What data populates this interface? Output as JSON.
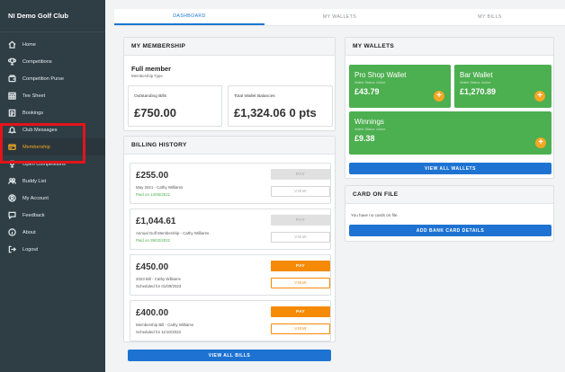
{
  "brand": "NI Demo Golf Club",
  "nav": [
    {
      "label": "Home",
      "icon": "home-icon"
    },
    {
      "label": "Competitions",
      "icon": "trophy-icon"
    },
    {
      "label": "Competition Purse",
      "icon": "purse-icon"
    },
    {
      "label": "Tee Sheet",
      "icon": "calendar-icon"
    },
    {
      "label": "Bookings",
      "icon": "bookings-icon"
    },
    {
      "label": "Club Messages",
      "icon": "bell-icon"
    },
    {
      "label": "Membership",
      "icon": "card-icon",
      "active": true
    },
    {
      "label": "Open Competitions",
      "icon": "trophy-icon"
    },
    {
      "label": "Buddy List",
      "icon": "group-icon"
    },
    {
      "label": "My Account",
      "icon": "user-icon"
    },
    {
      "label": "Feedback",
      "icon": "chat-icon"
    },
    {
      "label": "About",
      "icon": "info-icon"
    },
    {
      "label": "Logout",
      "icon": "logout-icon"
    }
  ],
  "tabs": [
    "DASHBOARD",
    "MY WALLETS",
    "MY BILLS"
  ],
  "membership": {
    "header": "MY MEMBERSHIP",
    "type": "Full member",
    "type_label": "Membership Type",
    "outstanding_label": "Outstanding Bills",
    "outstanding_value": "£750.00",
    "wallet_label": "Total Wallet Balances",
    "wallet_value": "£1,324.06  0 pts"
  },
  "billing": {
    "header": "BILLING HISTORY",
    "bills": [
      {
        "amount": "£255.00",
        "desc": "May 2021 - Cathy Williams",
        "status": "Paid on 13/06/2021",
        "pay": "PAY",
        "view": "VIEW"
      },
      {
        "amount": "£1,044.61",
        "desc": "Annual Golf Membership - Cathy Williams",
        "status": "Paid on 28/02/2022",
        "pay": "PAY",
        "view": "VIEW"
      },
      {
        "amount": "£450.00",
        "desc": "2023 Bill - Cathy Williams",
        "status": "Scheduled for 01/09/2023",
        "pay": "PAY",
        "view": "VIEW"
      },
      {
        "amount": "£400.00",
        "desc": "Membership Bill - Cathy Williams",
        "status": "Scheduled for 11/10/2023",
        "pay": "PAY",
        "view": "VIEW"
      }
    ],
    "view_all": "VIEW ALL BILLS"
  },
  "wallets": {
    "header": "MY WALLETS",
    "items": [
      {
        "name": "Pro Shop Wallet",
        "status": "Wallet Status: Active",
        "value": "£43.79"
      },
      {
        "name": "Bar Wallet",
        "status": "Wallet Status: Active",
        "value": "£1,270.89"
      },
      {
        "name": "Winnings",
        "status": "Wallet Status: Active",
        "value": "£9.38"
      }
    ],
    "view_all": "VIEW ALL WALLETS"
  },
  "card_on_file": {
    "header": "CARD ON FILE",
    "message": "You have no cards on file.",
    "button": "ADD BANK CARD DETAILS"
  },
  "colors": {
    "sidebar": "#2f3d44",
    "accent": "#f5a623",
    "primary": "#1e73d2",
    "wallet": "#4caf50",
    "highlight": "#e3141b"
  }
}
